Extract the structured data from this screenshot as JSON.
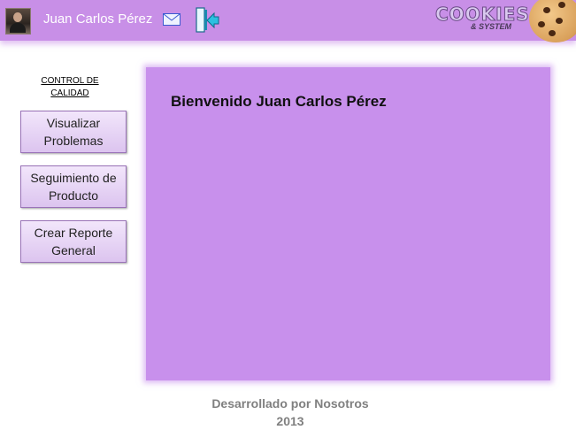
{
  "header": {
    "user_name": "Juan Carlos Pérez",
    "avatar_icon": "user-avatar",
    "mail_icon": "envelope-icon",
    "logout_icon": "logout-arrow-icon",
    "logo": {
      "title": "COOKIES",
      "subtitle": "& SYSTEM"
    },
    "colors": {
      "bar": "#c88fe7"
    }
  },
  "sidebar": {
    "section_title": "CONTROL DE CALIDAD",
    "buttons": [
      {
        "label": "Visualizar Problemas"
      },
      {
        "label": "Seguimiento de Producto"
      },
      {
        "label": "Crear Reporte General"
      }
    ]
  },
  "main": {
    "welcome": "Bienvenido Juan Carlos Pérez",
    "colors": {
      "panel": "#c890ec"
    }
  },
  "footer": {
    "line1": "Desarrollado por Nosotros",
    "line2": "2013"
  }
}
